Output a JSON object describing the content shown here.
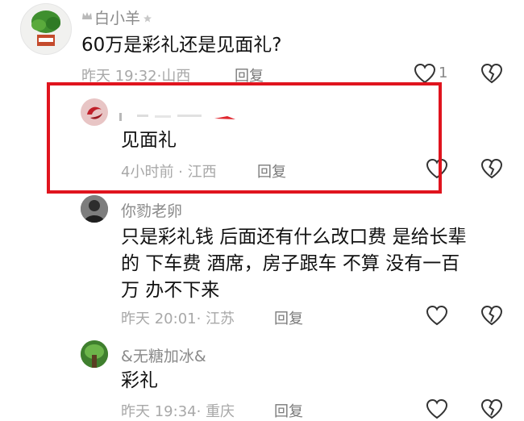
{
  "comments": [
    {
      "username": "白小羊",
      "text": "60万是彩礼还是见面礼?",
      "time": "昨天 19:32",
      "location": "山西",
      "reply_label": "回复",
      "like_count": "1"
    },
    {
      "username": "",
      "text": "见面礼",
      "time": "4小时前",
      "location": "江西",
      "reply_label": "回复"
    },
    {
      "username": "你勠老卵",
      "text_lines": [
        "只是彩礼钱 后面还有什么改口费 是给长辈",
        "的 下车费 酒席，房子跟车 不算 没有一百",
        "万 办不下来"
      ],
      "time": "昨天 20:01",
      "location": "江苏",
      "reply_label": "回复"
    },
    {
      "username": "&无糖加冰&",
      "text": "彩礼",
      "time": "昨天 19:34",
      "location": "重庆",
      "reply_label": "回复"
    }
  ],
  "colors": {
    "highlight_border": "#e0141e",
    "meta_text": "#a8a8a8",
    "icon_stroke": "#333333"
  },
  "icons": [
    "like-heart-icon",
    "dislike-broken-heart-icon"
  ]
}
